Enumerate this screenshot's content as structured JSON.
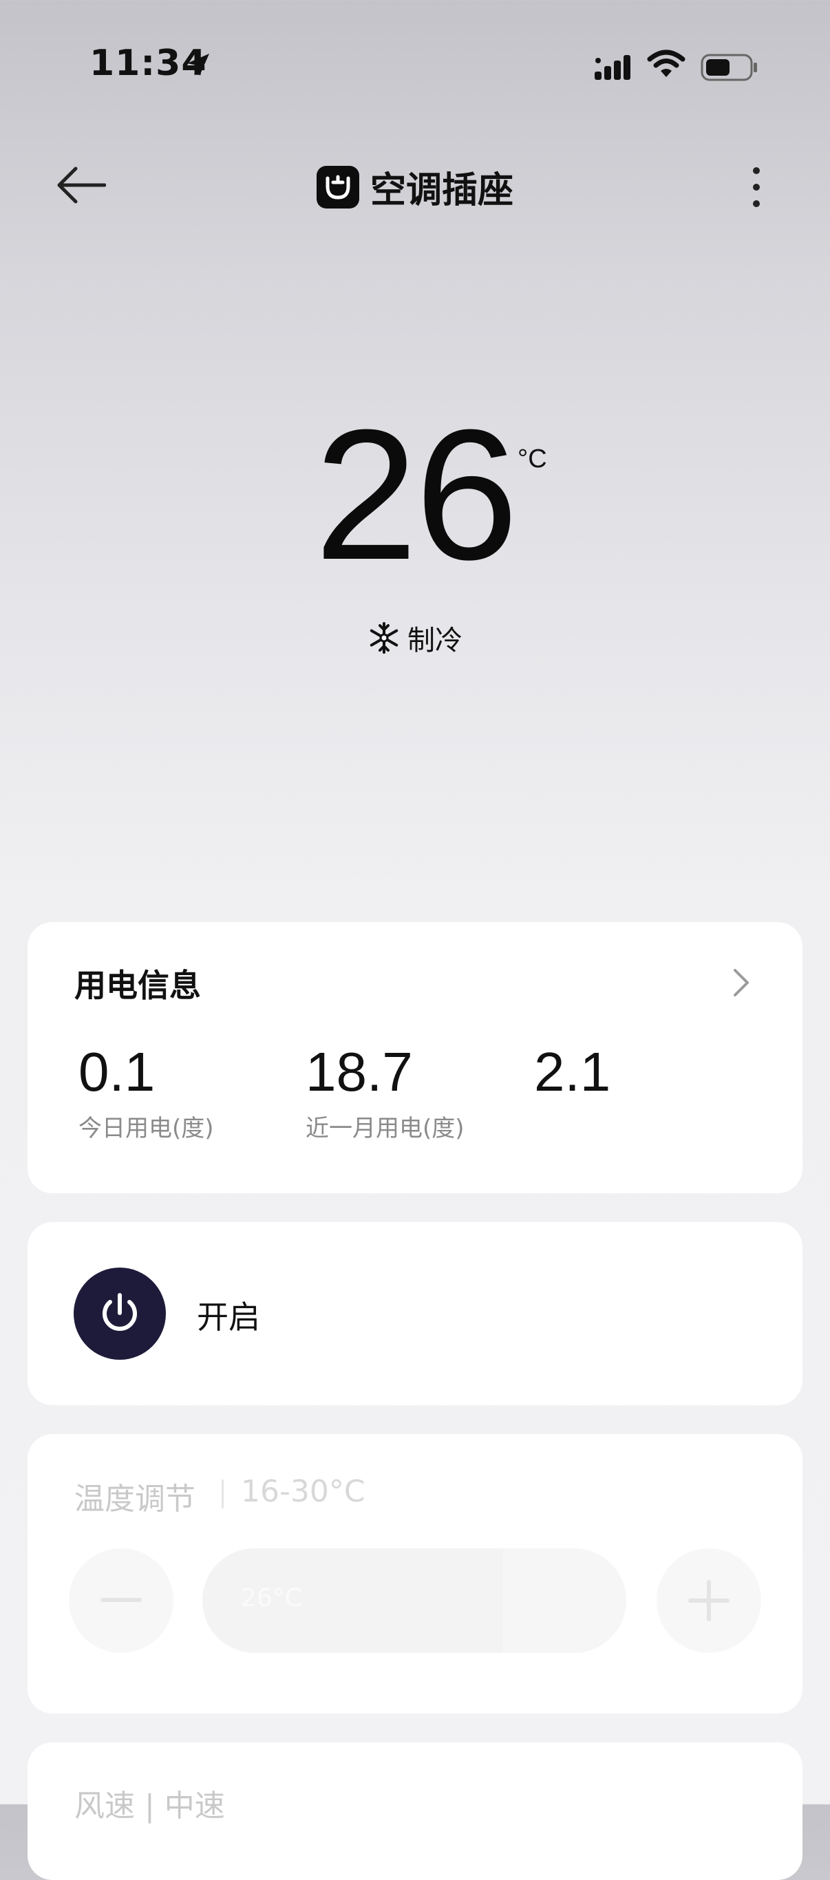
{
  "status": {
    "time": "11:34"
  },
  "nav": {
    "title": "空调插座"
  },
  "hero": {
    "temperature": "26",
    "unit": "°C",
    "mode": "制冷"
  },
  "energy": {
    "title": "用电信息",
    "stats": [
      {
        "value": "0.1",
        "label": "今日用电(度)"
      },
      {
        "value": "18.7",
        "label": "近一月用电(度)"
      },
      {
        "value": "2.1",
        "label": ""
      }
    ]
  },
  "power": {
    "label": "开启"
  },
  "temp_control": {
    "title": "温度调节",
    "range": "16-30°C",
    "value_label": "26°C",
    "level_fraction": 0.71
  },
  "wind": {
    "title": "风速 | 中速"
  }
}
